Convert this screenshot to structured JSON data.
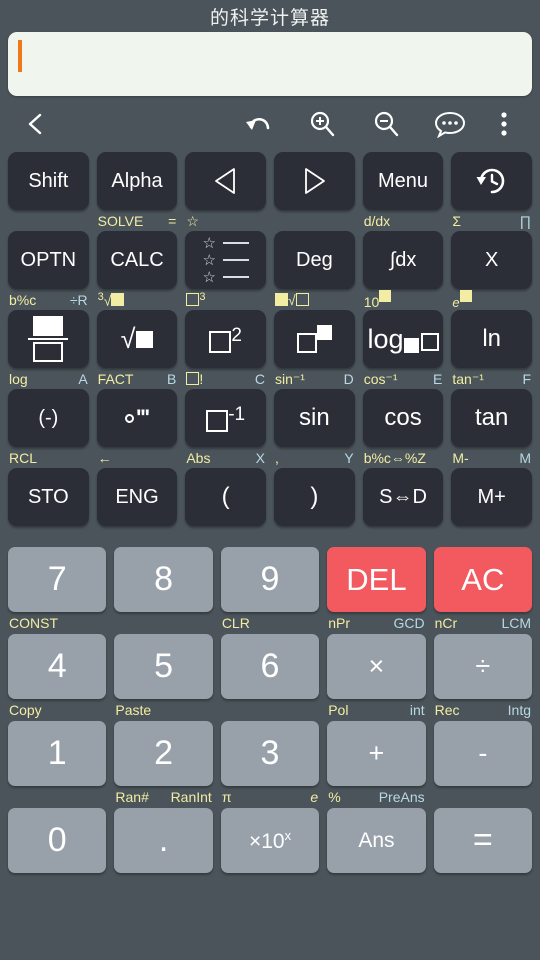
{
  "app": {
    "title": "的科学计算器",
    "colors": {
      "background": "#4a545a",
      "display_bg": "#f0f6ee",
      "caret": "#f07818",
      "key_dark": "#2b2d37",
      "key_gray": "#98a0aa",
      "key_red": "#f25a5f",
      "label_yellow": "#f2eda2",
      "label_blue": "#b8d8e4"
    }
  },
  "display": {
    "value": "",
    "placeholder": ""
  },
  "toolbar": {
    "back": "back-icon",
    "undo": "undo-icon",
    "zoom_in": "zoom-in-icon",
    "zoom_out": "zoom-out-icon",
    "chat": "chat-bubble-icon",
    "more": "overflow-menu-icon"
  },
  "keypad": {
    "rows": [
      {
        "name": "row-modifiers",
        "keys": [
          {
            "label": "Shift",
            "shift": "",
            "alpha": ""
          },
          {
            "label": "Alpha",
            "shift": "SOLVE",
            "alpha": "="
          },
          {
            "label": "◁",
            "shift": "☆",
            "alpha": ""
          },
          {
            "label": "▷",
            "shift": "",
            "alpha": ""
          },
          {
            "label": "Menu",
            "shift": "d/dx",
            "alpha": ""
          },
          {
            "label": "history",
            "shift": "Σ",
            "alpha": "∏"
          }
        ]
      },
      {
        "name": "row-functions",
        "keys": [
          {
            "label": "OPTN",
            "shift": "b%c",
            "alpha": "÷R"
          },
          {
            "label": "CALC",
            "shift": "³√■",
            "alpha": ""
          },
          {
            "label": "favorites",
            "shift": "□³",
            "alpha": ""
          },
          {
            "label": "Deg",
            "shift": "■√□",
            "alpha": ""
          },
          {
            "label": "∫dx",
            "shift": "10■",
            "alpha": ""
          },
          {
            "label": "X",
            "shift": "e■",
            "alpha": ""
          }
        ]
      },
      {
        "name": "row-powers",
        "keys": [
          {
            "label": "fraction",
            "shift": "log",
            "alpha": "A"
          },
          {
            "label": "√■",
            "shift": "FACT",
            "alpha": "B"
          },
          {
            "label": "□²",
            "shift": "□!",
            "alpha": "C"
          },
          {
            "label": "□^■",
            "shift": "sin⁻¹",
            "alpha": "D"
          },
          {
            "label": "log■□",
            "shift": "cos⁻¹",
            "alpha": "E"
          },
          {
            "label": "ln",
            "shift": "tan⁻¹",
            "alpha": "F"
          }
        ]
      },
      {
        "name": "row-trig",
        "keys": [
          {
            "label": "(-)",
            "shift": "RCL",
            "alpha": ""
          },
          {
            "label": "°'''",
            "shift": "←",
            "alpha": ""
          },
          {
            "label": "□⁻¹",
            "shift": "Abs",
            "alpha": "X"
          },
          {
            "label": "sin",
            "shift": ",",
            "alpha": "Y"
          },
          {
            "label": "cos",
            "shift": "b%c⇔%Z",
            "alpha": ""
          },
          {
            "label": "tan",
            "shift": "M-",
            "alpha": "M"
          }
        ]
      },
      {
        "name": "row-memory",
        "keys": [
          {
            "label": "STO",
            "shift": "",
            "alpha": ""
          },
          {
            "label": "ENG",
            "shift": "",
            "alpha": ""
          },
          {
            "label": "(",
            "shift": "",
            "alpha": ""
          },
          {
            "label": ")",
            "shift": "",
            "alpha": ""
          },
          {
            "label": "S⇔D",
            "shift": "",
            "alpha": ""
          },
          {
            "label": "M+",
            "shift": "",
            "alpha": ""
          }
        ]
      }
    ],
    "numeric_rows": [
      {
        "name": "row-789",
        "keys": [
          {
            "label": "7",
            "style": "gray",
            "shift": "CONST",
            "alpha": ""
          },
          {
            "label": "8",
            "style": "gray",
            "shift": "",
            "alpha": ""
          },
          {
            "label": "9",
            "style": "gray",
            "shift": "CLR",
            "alpha": ""
          },
          {
            "label": "DEL",
            "style": "red",
            "shift": "nPr",
            "alpha": "GCD"
          },
          {
            "label": "AC",
            "style": "red",
            "shift": "nCr",
            "alpha": "LCM"
          }
        ]
      },
      {
        "name": "row-456",
        "keys": [
          {
            "label": "4",
            "style": "gray",
            "shift": "Copy",
            "alpha": ""
          },
          {
            "label": "5",
            "style": "gray",
            "shift": "Paste",
            "alpha": ""
          },
          {
            "label": "6",
            "style": "gray",
            "shift": "",
            "alpha": ""
          },
          {
            "label": "×",
            "style": "gray",
            "shift": "Pol",
            "alpha": "int"
          },
          {
            "label": "÷",
            "style": "gray",
            "shift": "Rec",
            "alpha": "Intg"
          }
        ]
      },
      {
        "name": "row-123",
        "keys": [
          {
            "label": "1",
            "style": "gray",
            "shift": "",
            "alpha": ""
          },
          {
            "label": "2",
            "style": "gray",
            "shift": "Ran#",
            "alpha": "RanInt"
          },
          {
            "label": "3",
            "style": "gray",
            "shift": "π",
            "alpha": "e"
          },
          {
            "label": "+",
            "style": "gray",
            "shift": "%",
            "alpha": "PreAns"
          },
          {
            "label": "-",
            "style": "gray",
            "shift": "",
            "alpha": ""
          }
        ]
      },
      {
        "name": "row-0",
        "keys": [
          {
            "label": "0",
            "style": "gray",
            "shift": "",
            "alpha": ""
          },
          {
            "label": ".",
            "style": "gray",
            "shift": "",
            "alpha": ""
          },
          {
            "label": "×10ˣ",
            "style": "gray",
            "shift": "",
            "alpha": ""
          },
          {
            "label": "Ans",
            "style": "gray",
            "shift": "",
            "alpha": ""
          },
          {
            "label": "=",
            "style": "gray",
            "shift": "",
            "alpha": ""
          }
        ]
      }
    ]
  }
}
